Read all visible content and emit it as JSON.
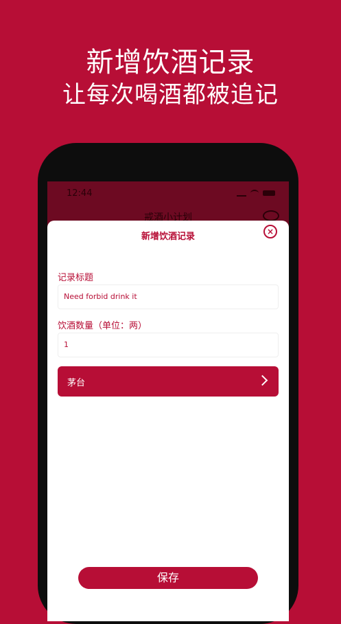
{
  "headline": {
    "line1": "新增饮酒记录",
    "line2": "让每次喝酒都被追记"
  },
  "status_bar": {
    "time": "12:44"
  },
  "background_screen": {
    "title": "戒酒小计划"
  },
  "sheet": {
    "title": "新增饮酒记录",
    "close_icon": "close-circle-icon",
    "title_field": {
      "label": "记录标题",
      "value": "Need forbid drink it"
    },
    "amount_field": {
      "label": "饮酒数量（单位：两）",
      "value": "1"
    },
    "brand_select": {
      "value": "茅台",
      "icon": "chevron-right-icon"
    },
    "save_label": "保存"
  },
  "colors": {
    "accent": "#b70e36",
    "background": "#b70e36",
    "dim_overlay": "#6d0a22"
  }
}
